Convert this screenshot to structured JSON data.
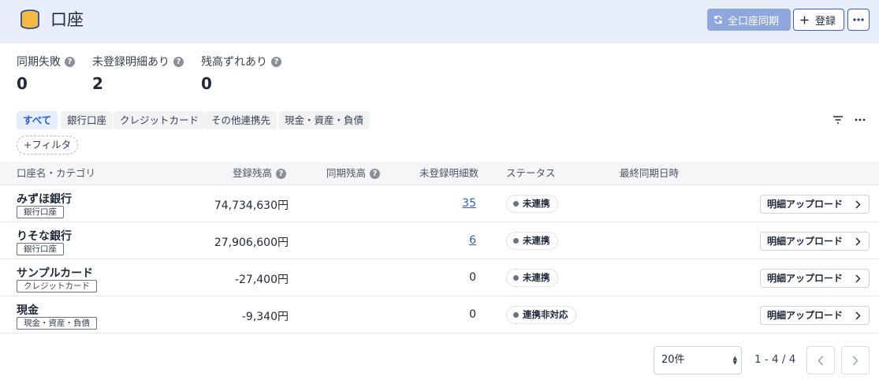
{
  "header": {
    "title": "口座",
    "sync_all_label": "全口座同期",
    "register_label": "登録"
  },
  "stats": [
    {
      "label": "同期失敗",
      "value": "0"
    },
    {
      "label": "未登録明細あり",
      "value": "2"
    },
    {
      "label": "残高ずれあり",
      "value": "0"
    }
  ],
  "filters": {
    "chips": [
      "すべて",
      "銀行口座",
      "クレジットカード",
      "その他連携先",
      "現金・資産・負債"
    ],
    "active": "すべて",
    "add_filter_label": "+フィルタ"
  },
  "table": {
    "columns": [
      "口座名・カテゴリ",
      "登録残高",
      "同期残高",
      "未登録明細数",
      "ステータス",
      "最終同期日時"
    ],
    "upload_label": "明細アップロード",
    "rows": [
      {
        "name": "みずほ銀行",
        "category": "銀行口座",
        "balance": "74,734,630円",
        "unregistered": "35",
        "status": "未連携"
      },
      {
        "name": "りそな銀行",
        "category": "銀行口座",
        "balance": "27,906,600円",
        "unregistered": "6",
        "status": "未連携"
      },
      {
        "name": "サンプルカード",
        "category": "クレジットカード",
        "balance": "-27,400円",
        "unregistered": "0",
        "status": "未連携"
      },
      {
        "name": "現金",
        "category": "現金・資産・負債",
        "balance": "-9,340円",
        "unregistered": "0",
        "status": "連携非対応"
      }
    ]
  },
  "pagination": {
    "per_page": "20件",
    "range": "1 - 4 / 4"
  },
  "colors": {
    "header_bg": "#e8eefa",
    "accent": "#2f5bd3",
    "sync_button": "#8fa7dd"
  }
}
